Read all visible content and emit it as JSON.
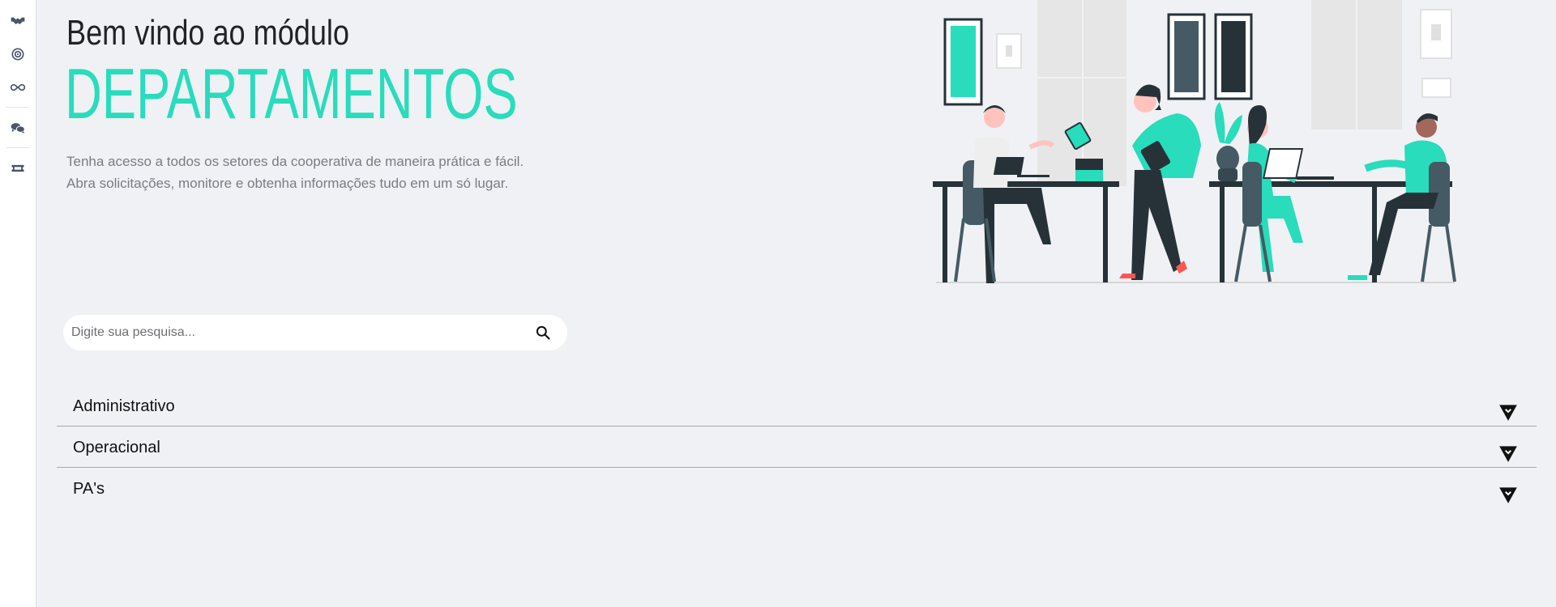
{
  "sidebar": {
    "items": [
      {
        "icon": "handshake-icon"
      },
      {
        "icon": "target-icon"
      },
      {
        "icon": "infinity-icon"
      },
      {
        "icon": "chat-bubbles-icon"
      },
      {
        "icon": "ticket-icon"
      }
    ]
  },
  "hero": {
    "title_prefix": "Bem vindo ao módulo",
    "title_main": "DEPARTAMENTOS",
    "description_line1": "Tenha acesso a todos os setores da cooperativa de maneira prática e fácil.",
    "description_line2": "Abra solicitações, monitore e obtenha informações tudo em um só lugar."
  },
  "search": {
    "placeholder": "Digite sua pesquisa...",
    "value": ""
  },
  "departments": [
    {
      "label": "Administrativo"
    },
    {
      "label": "Operacional"
    },
    {
      "label": "PA's"
    }
  ],
  "colors": {
    "accent": "#28dcbc",
    "background": "#f0f1f5",
    "dark": "#263238"
  }
}
